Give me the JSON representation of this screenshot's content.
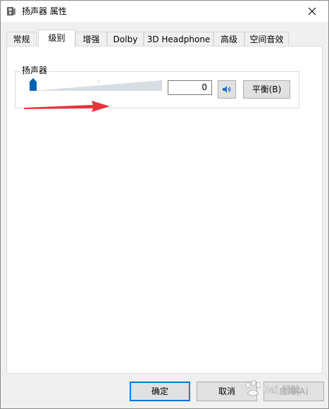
{
  "window": {
    "title": "扬声器 属性",
    "close_glyph": "✕"
  },
  "tabs": [
    {
      "label": "常规",
      "active": false
    },
    {
      "label": "级别",
      "active": true
    },
    {
      "label": "增强",
      "active": false
    },
    {
      "label": "Dolby",
      "active": false
    },
    {
      "label": "3D Headphone",
      "active": false
    },
    {
      "label": "高级",
      "active": false
    },
    {
      "label": "空间音效",
      "active": false
    }
  ],
  "levels": {
    "group_label": "扬声器",
    "volume_value": "0",
    "volume_level_percent": 0,
    "mute_icon": "speaker-icon",
    "balance_label": "平衡(B)"
  },
  "annotation": {
    "arrow_color": "#e8333a"
  },
  "footer": {
    "ok_label": "确定",
    "cancel_label": "取消",
    "apply_label": "应用(A)"
  },
  "colors": {
    "accent": "#0078d7",
    "slider_thumb": "#0063b1"
  }
}
